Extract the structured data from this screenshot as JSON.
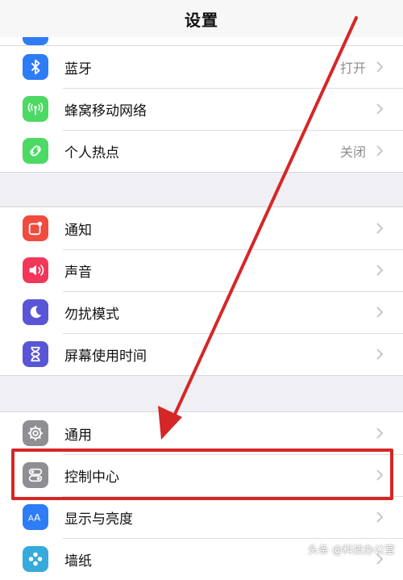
{
  "navbar": {
    "title": "设置"
  },
  "groups": [
    {
      "rows": [
        {
          "label": "蓝牙",
          "value": "打开",
          "icon": "bluetooth-icon",
          "color": "#2e7cf6"
        },
        {
          "label": "蜂窝移动网络",
          "value": "",
          "icon": "cellular-antenna-icon",
          "color": "#4cd964"
        },
        {
          "label": "个人热点",
          "value": "关闭",
          "icon": "hotspot-link-icon",
          "color": "#4cd964"
        }
      ]
    },
    {
      "rows": [
        {
          "label": "通知",
          "value": "",
          "icon": "notification-badge-icon",
          "color": "#f04b3e"
        },
        {
          "label": "声音",
          "value": "",
          "icon": "speaker-icon",
          "color": "#f2375a"
        },
        {
          "label": "勿扰模式",
          "value": "",
          "icon": "moon-icon",
          "color": "#5856d6"
        },
        {
          "label": "屏幕使用时间",
          "value": "",
          "icon": "hourglass-icon",
          "color": "#5856d6"
        }
      ]
    },
    {
      "rows": [
        {
          "label": "通用",
          "value": "",
          "icon": "gear-icon",
          "color": "#8e8e93"
        },
        {
          "label": "控制中心",
          "value": "",
          "icon": "toggle-switches-icon",
          "color": "#8e8e93"
        },
        {
          "label": "显示与亮度",
          "value": "",
          "icon": "text-size-aa-icon",
          "color": "#2e7cf6"
        },
        {
          "label": "墙纸",
          "value": "",
          "icon": "flower-icon",
          "color": "#36aadc"
        }
      ]
    }
  ],
  "watermark": "头条 @科技办公室"
}
